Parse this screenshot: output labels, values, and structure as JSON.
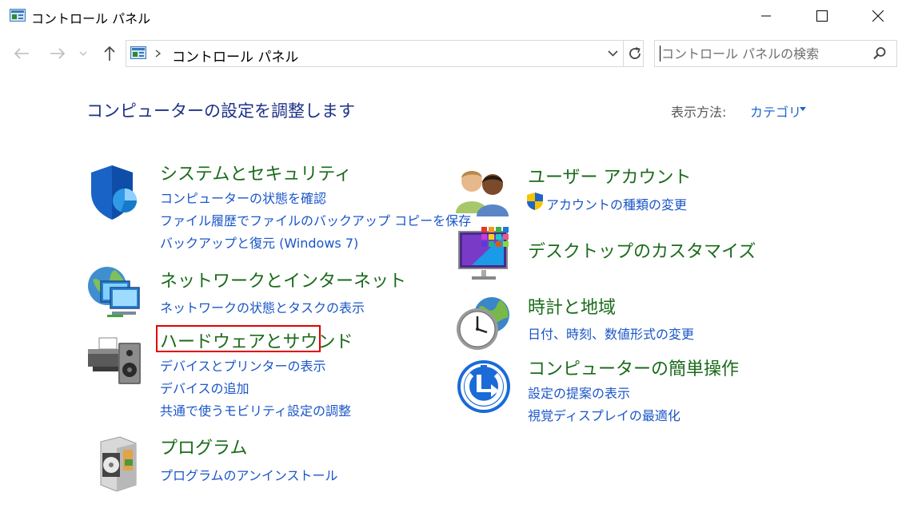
{
  "window": {
    "title": "コントロール パネル",
    "minimize_glyph": "—",
    "maximize_glyph": "☐",
    "close_glyph": "✕"
  },
  "nav": {
    "back_glyph": "←",
    "forward_glyph": "→",
    "recent_glyph": "⌄",
    "up_glyph": "↑",
    "breadcrumb_sep": "›",
    "address_text": "コントロール パネル",
    "dropdown_glyph": "⌄",
    "refresh_glyph": "↻",
    "search_placeholder": "コントロール パネルの検索"
  },
  "header": {
    "title": "コンピューターの設定を調整します",
    "view_by_label": "表示方法:",
    "view_by_value": "カテゴリ",
    "view_by_arrow": "▾"
  },
  "categories": {
    "system": {
      "title": "システムとセキュリティ",
      "links": [
        "コンピューターの状態を確認",
        "ファイル履歴でファイルのバックアップ コピーを保存",
        "バックアップと復元 (Windows 7)"
      ]
    },
    "network": {
      "title": "ネットワークとインターネット",
      "links": [
        "ネットワークの状態とタスクの表示"
      ]
    },
    "hardware": {
      "title": "ハードウェアとサウンド",
      "links": [
        "デバイスとプリンターの表示",
        "デバイスの追加",
        "共通で使うモビリティ設定の調整"
      ]
    },
    "programs": {
      "title": "プログラム",
      "links": [
        "プログラムのアンインストール"
      ]
    },
    "user_accounts": {
      "title": "ユーザー アカウント",
      "links": [
        "アカウントの種類の変更"
      ]
    },
    "appearance": {
      "title": "デスクトップのカスタマイズ",
      "links": []
    },
    "clock": {
      "title": "時計と地域",
      "links": [
        "日付、時刻、数値形式の変更"
      ]
    },
    "ease": {
      "title": "コンピューターの簡単操作",
      "links": [
        "設定の提案の表示",
        "視覚ディスプレイの最適化"
      ]
    }
  },
  "colors": {
    "category_title": "#1a6b1a",
    "link": "#1a56c8",
    "heading": "#1e3287",
    "highlight_border": "#e00000"
  },
  "icons": [
    "control-panel-icon",
    "shield-icon",
    "network-icon",
    "printer-speaker-icon",
    "programs-icon",
    "users-icon",
    "uac-shield-icon",
    "display-icon",
    "clock-globe-icon",
    "ease-of-access-icon",
    "search-icon",
    "refresh-icon"
  ]
}
